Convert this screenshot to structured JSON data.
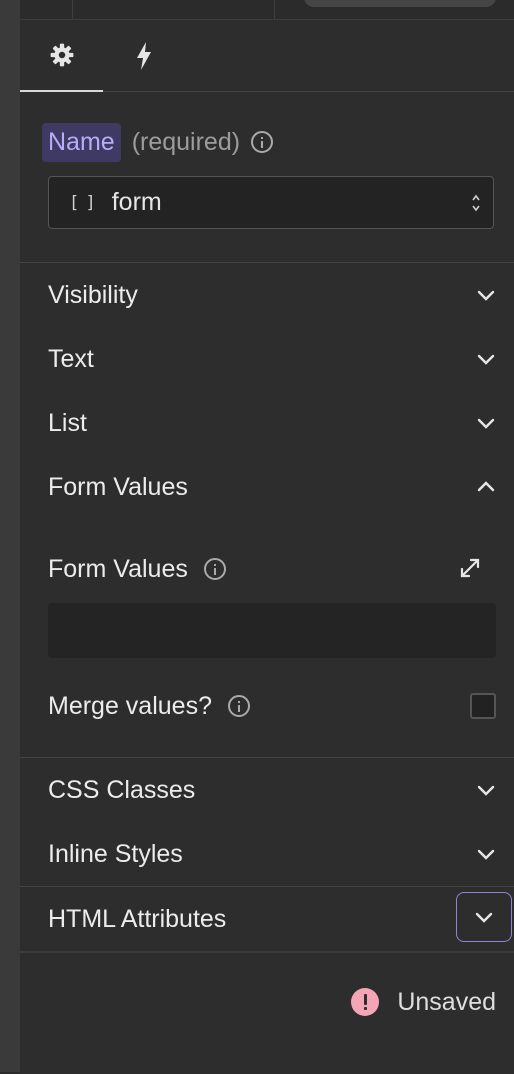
{
  "tabs": [
    {
      "icon": "gear-icon",
      "active": true
    },
    {
      "icon": "lightning-icon",
      "active": false
    }
  ],
  "name_section": {
    "label": "Name",
    "required": "(required)",
    "value": "form"
  },
  "sections": {
    "visibility": "Visibility",
    "text": "Text",
    "list": "List",
    "form_values": "Form Values",
    "css_classes": "CSS Classes",
    "inline_styles": "Inline Styles",
    "html_attributes": "HTML Attributes"
  },
  "form_values_body": {
    "label": "Form Values",
    "value": "",
    "merge_label": "Merge values?",
    "merge_checked": false
  },
  "status": {
    "text": "Unsaved",
    "color": "#f4a6b6"
  },
  "colors": {
    "accent": "#8e86d6",
    "name_chip_bg": "#3f3a63",
    "name_chip_text": "#b7acf6"
  }
}
